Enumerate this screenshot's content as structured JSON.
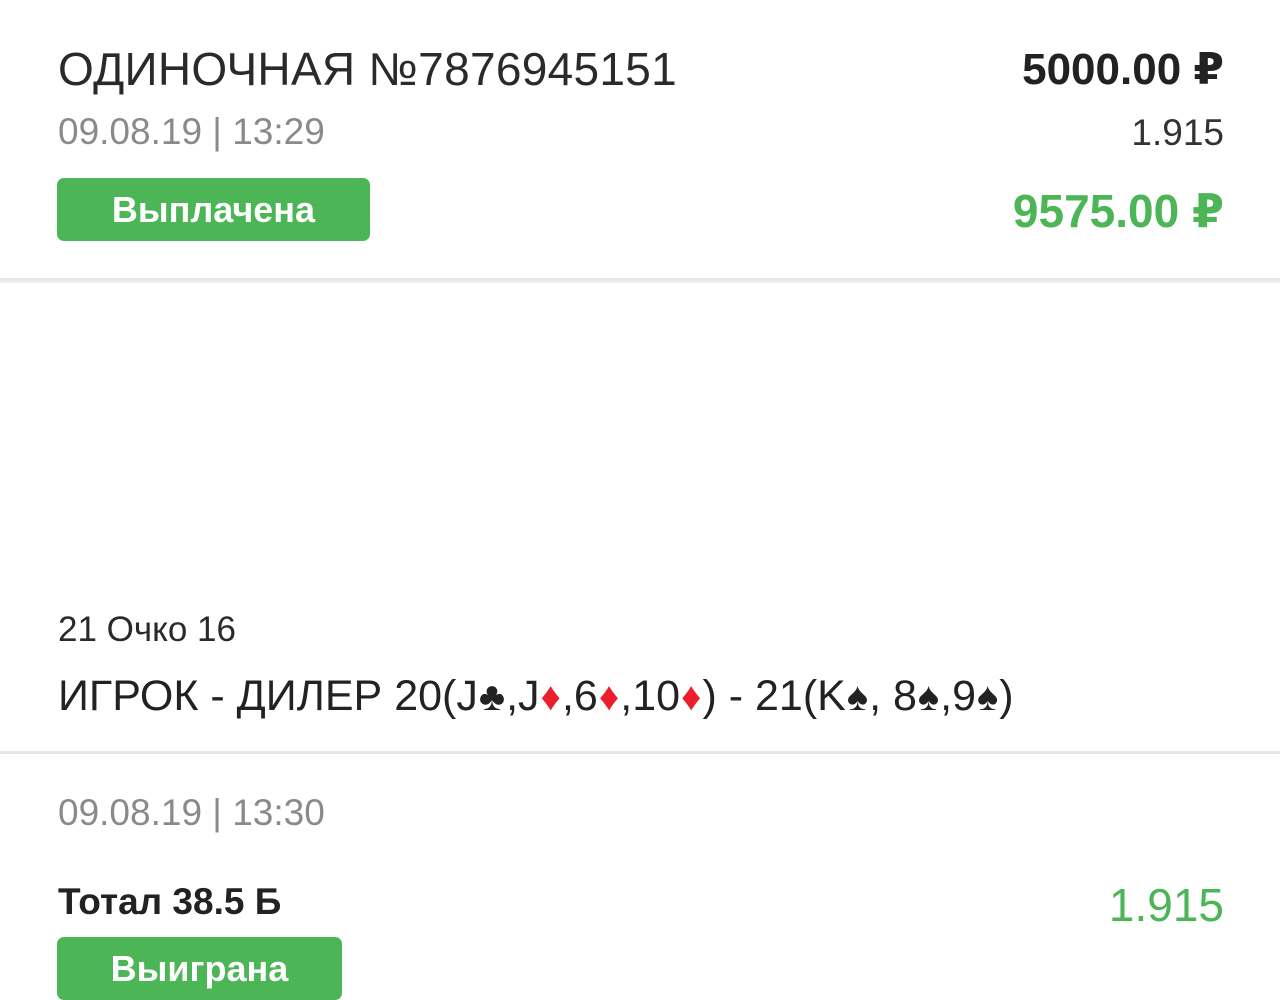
{
  "bet": {
    "title": "ОДИНОЧНАЯ №7876945151",
    "datetime": "09.08.19 | 13:29",
    "status": "Выплачена",
    "stake": "5000.00 ₽",
    "coefficient": "1.915",
    "payout": "9575.00 ₽"
  },
  "event": {
    "name": "21 Очко 16",
    "description": {
      "prefix": "ИГРОК - ДИЛЕР 20(J",
      "c1": "♣",
      "t1": ",J",
      "c2": "♦",
      "t2": ",6",
      "c3": "♦",
      "t3": ",10",
      "c4": "♦",
      "t4": ") - 21(K",
      "c5": "♠",
      "t5": ", 8",
      "c6": "♠",
      "t6": ",9",
      "c7": "♠",
      "t7": ")"
    },
    "datetime": "09.08.19 | 13:30",
    "market": "Тотал 38.5 Б",
    "coefficient": "1.915",
    "status": "Выиграна"
  },
  "colors": {
    "accent_green": "#4cb556",
    "suit_red": "#ea1f2b"
  }
}
